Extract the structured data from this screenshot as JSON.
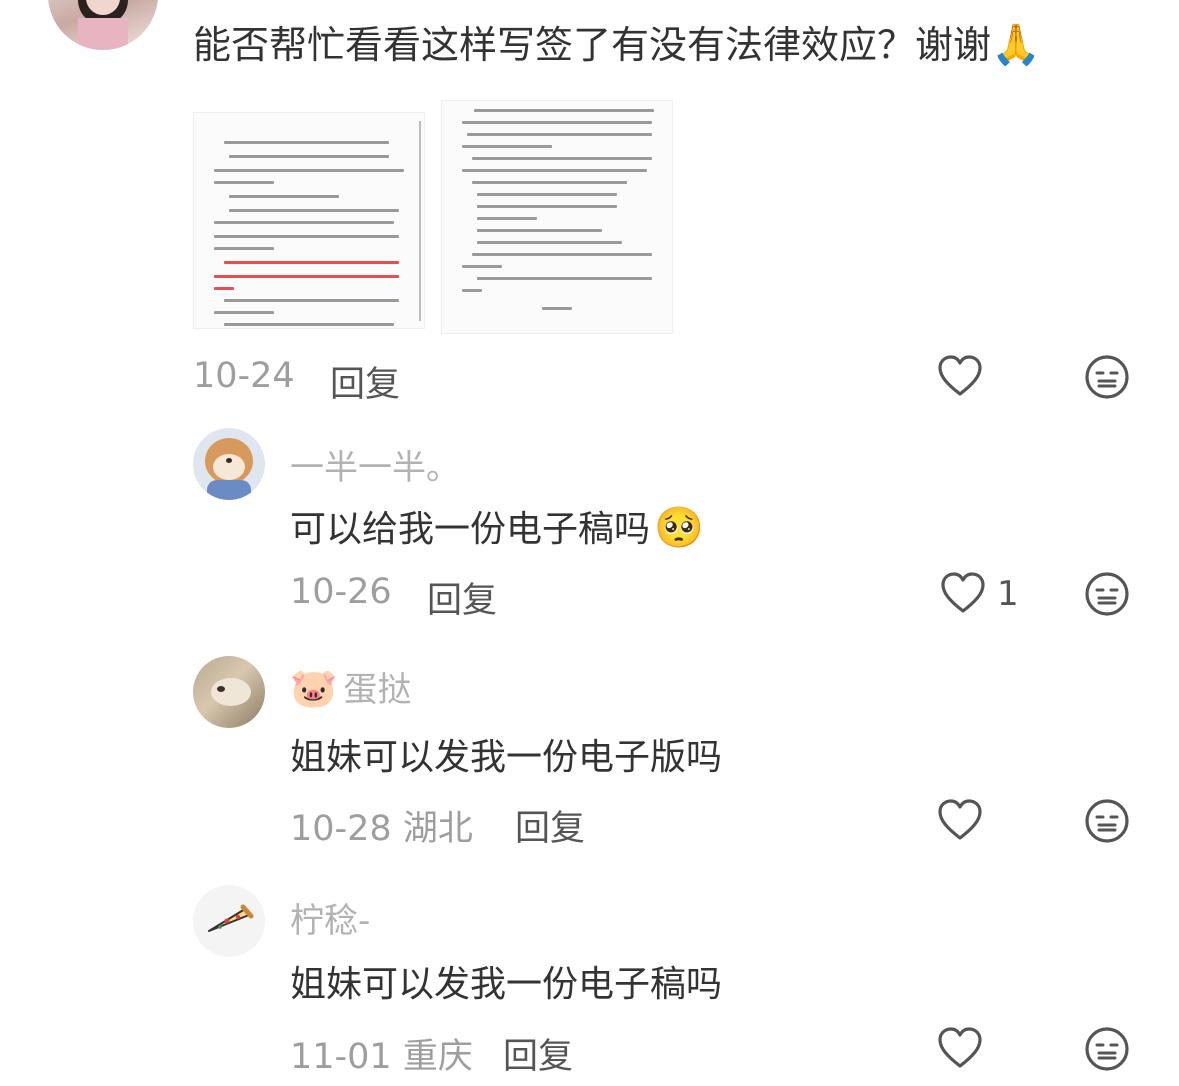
{
  "post": {
    "text": "能否帮忙看看这样写签了有没有法律效应？谢谢",
    "emoji": "🙏",
    "date": "10-24",
    "reply_label": "回复"
  },
  "comments": [
    {
      "username": "一半一半。",
      "text": "可以给我一份电子稿吗",
      "emoji": "🥺",
      "date": "10-26",
      "location": "",
      "reply_label": "回复",
      "like_count": "1"
    },
    {
      "username_emoji": "🐷",
      "username": "蛋挞",
      "text": "姐妹可以发我一份电子版吗",
      "date": "10-28",
      "location": "湖北",
      "reply_label": "回复",
      "like_count": ""
    },
    {
      "username": "柠稔-",
      "text": "姐妹可以发我一份电子稿吗",
      "date": "11-01",
      "location": "重庆",
      "reply_label": "回复",
      "like_count": ""
    }
  ],
  "icons": {
    "like": "heart-icon",
    "dislike": "meh-face-icon"
  },
  "colors": {
    "text": "#333333",
    "muted": "#9e9e9e",
    "username": "#b2b2b2",
    "icon": "#555555",
    "document_red": "#e25050"
  }
}
